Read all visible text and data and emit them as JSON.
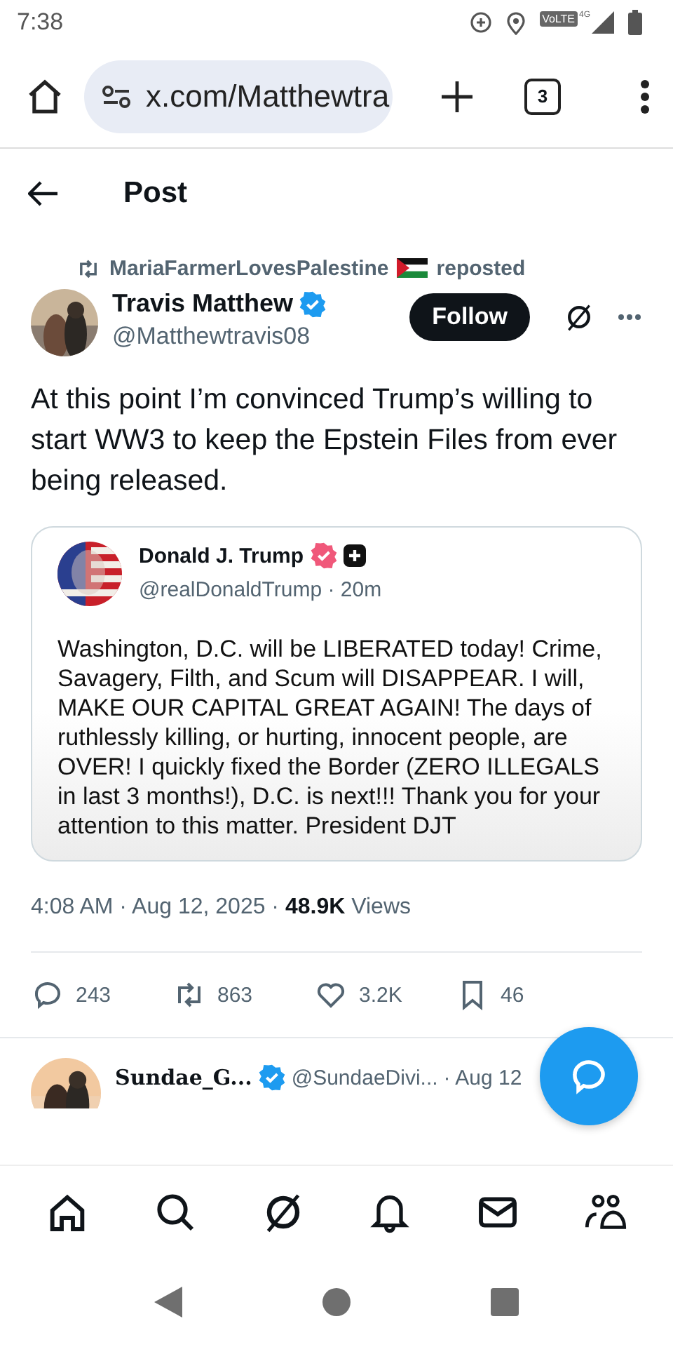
{
  "status_bar": {
    "time": "7:38",
    "network_label": "VoLTE",
    "network_type": "4G"
  },
  "browser": {
    "url": "x.com/Matthewtra",
    "tab_count": "3"
  },
  "header": {
    "title": "Post"
  },
  "post": {
    "repost_by": "MariaFarmerLovesPalestine",
    "repost_label": "reposted",
    "author": {
      "name": "Travis Matthew",
      "handle": "@Matthewtravis08",
      "verified": true
    },
    "follow_label": "Follow",
    "text": "At this point I’m convinced Trump’s willing to start WW3 to keep the Epstein Files from ever being released.",
    "quote": {
      "name": "Donald J. Trump",
      "handle": "@realDonaldTrump · 20m",
      "verified": true,
      "text": "Washington, D.C. will be LIBERATED today! Crime, Savagery, Filth, and Scum will DISAPPEAR. I will, MAKE OUR CAPITAL GREAT AGAIN! The days of ruthlessly killing, or hurting, innocent people, are OVER! I quickly fixed the Border (ZERO ILLEGALS in last 3 months!), D.C. is next!!! Thank you for your attention to this matter. President DJT"
    },
    "meta": "4:08 AM · Aug 12, 2025 · **48.9K** Views",
    "stats": [
      {
        "kind": "reply",
        "count": "243"
      },
      {
        "kind": "repost",
        "count": "863"
      },
      {
        "kind": "like",
        "count": "3.2K"
      },
      {
        "kind": "bookmark",
        "count": "46"
      }
    ]
  },
  "reply": {
    "name": "Sundae_G...",
    "handle": "@SundaeDivi...",
    "time": "· Aug 12",
    "verified": true
  },
  "nav": [
    {
      "kind": "home"
    },
    {
      "kind": "search"
    },
    {
      "kind": "grok"
    },
    {
      "kind": "notifications"
    },
    {
      "kind": "messages"
    },
    {
      "kind": "communities"
    }
  ]
}
